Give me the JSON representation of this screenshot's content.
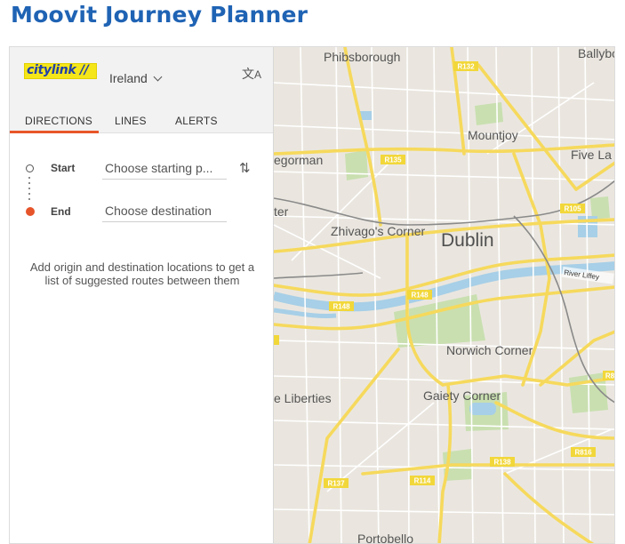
{
  "page": {
    "title": "Moovit Journey Planner"
  },
  "panel": {
    "logo_text": "citylink //",
    "region": "Ireland",
    "tabs": [
      {
        "label": "DIRECTIONS",
        "active": true
      },
      {
        "label": "LINES",
        "active": false
      },
      {
        "label": "ALERTS",
        "active": false
      }
    ],
    "start": {
      "label": "Start",
      "placeholder": "Choose starting p..."
    },
    "end": {
      "label": "End",
      "placeholder": "Choose destination"
    },
    "hint": "Add origin and destination locations to get a list of suggested routes between them"
  },
  "map": {
    "places": [
      "Phibsborough",
      "Ballybo",
      "Mountjoy",
      "egorman",
      "Five La",
      "ter",
      "Zhivago's Corner",
      "Dublin",
      "River Liffey",
      "Norwich Corner",
      "Gaiety Corner",
      "e Liberties",
      "Portobello"
    ],
    "roads": [
      "R132",
      "R135",
      "R105",
      "R148",
      "R148",
      "R138",
      "R816",
      "R137",
      "R114",
      "R8"
    ]
  },
  "colors": {
    "accent": "#e8562a",
    "title": "#1f63b4",
    "road_badge": "#f2d73a",
    "water": "#a7cfe7",
    "park": "#c9dfb0"
  },
  "icons": {
    "translate": "translate-icon",
    "swap": "swap-icon",
    "region": "chevron-down-icon"
  }
}
